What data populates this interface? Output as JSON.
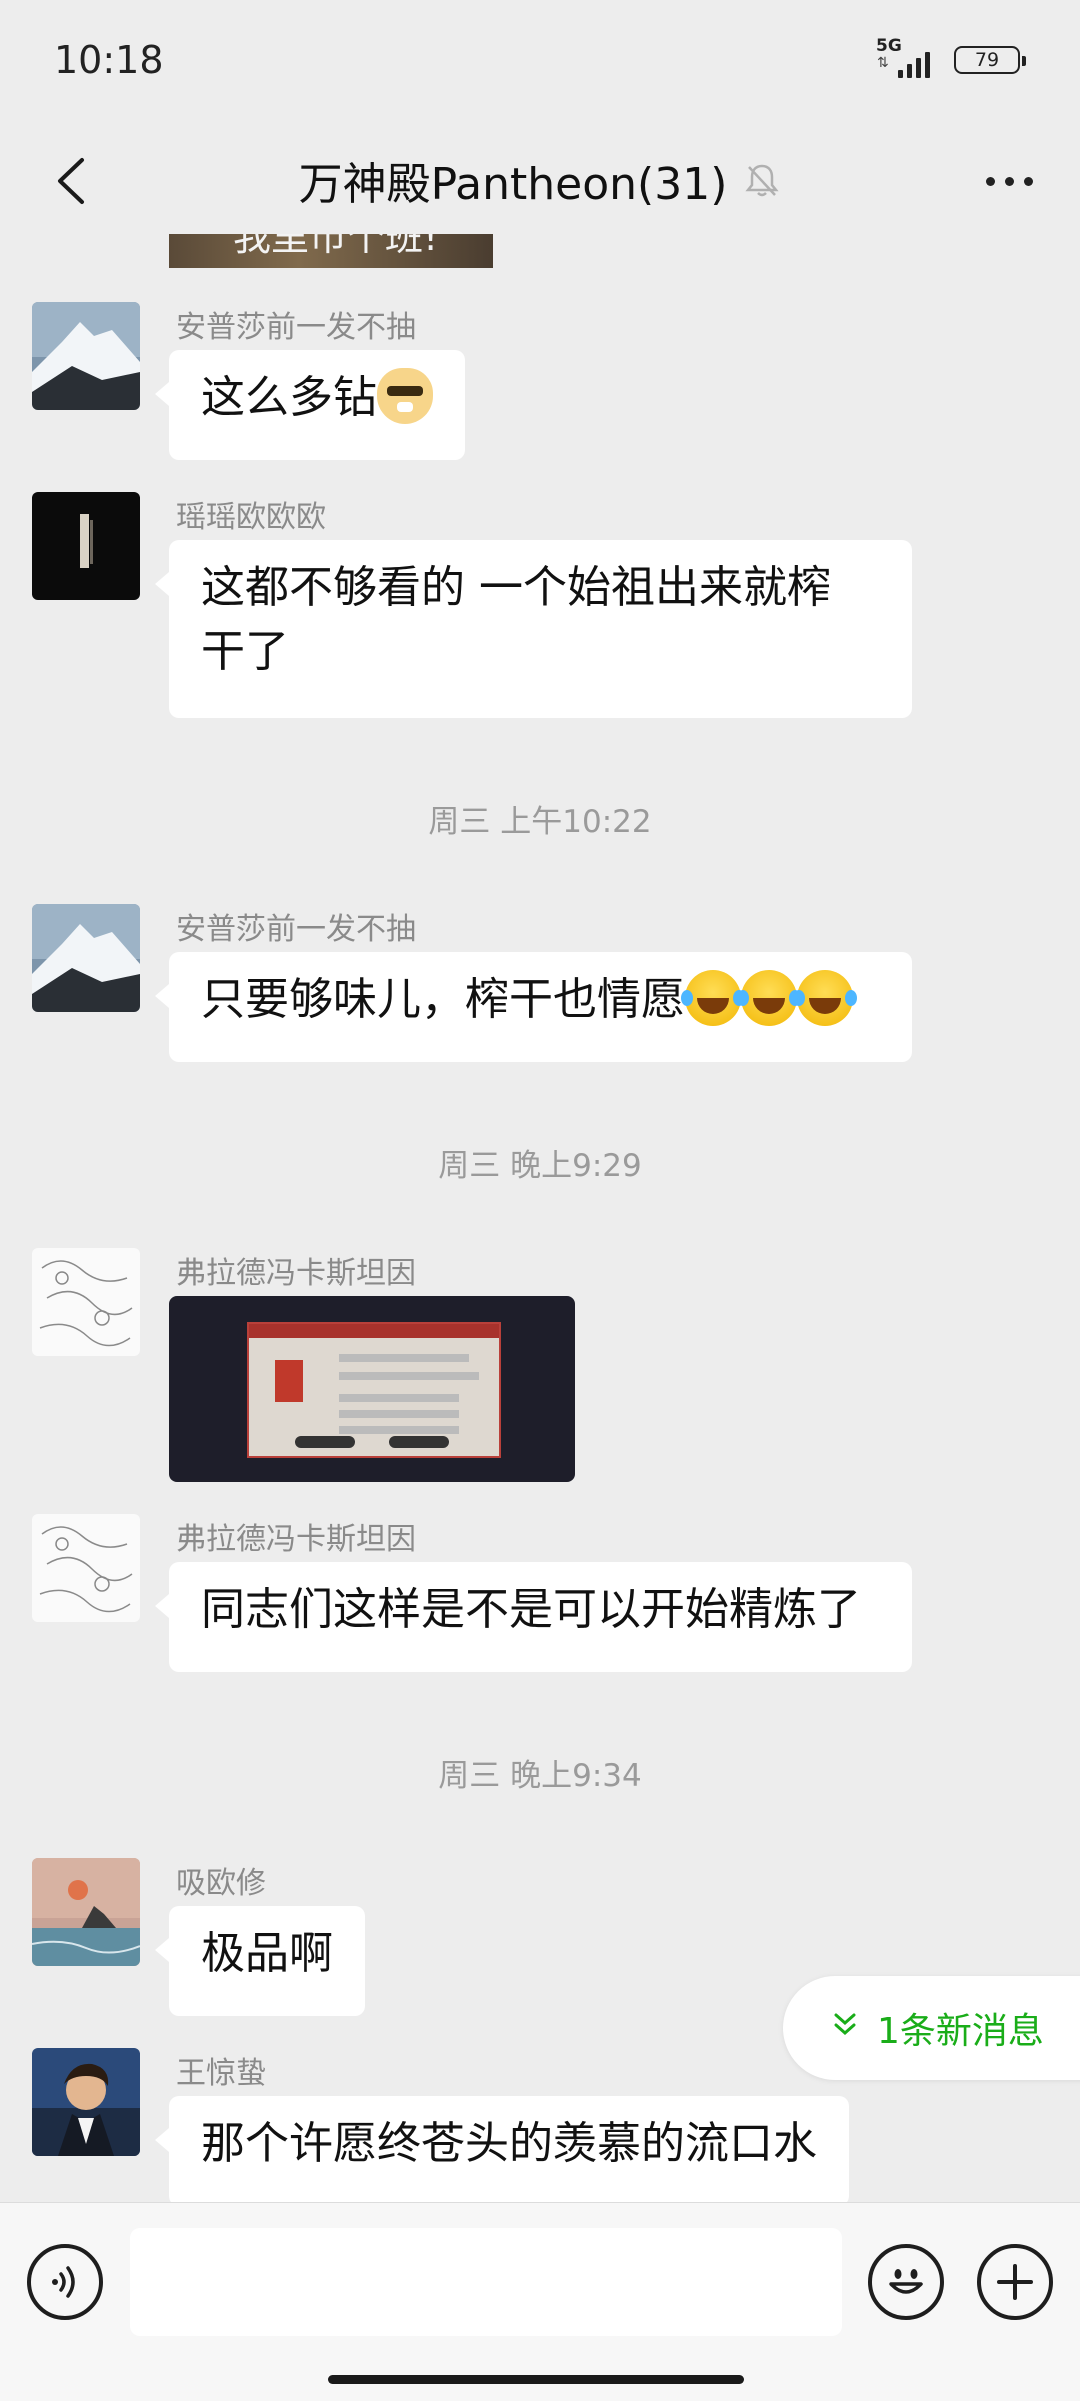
{
  "status": {
    "time": "10:18",
    "network": "5G",
    "battery": "79"
  },
  "header": {
    "title": "万神殿Pantheon(31)",
    "muted": true
  },
  "partial_image_caption": "我里市个班!",
  "messages": [
    {
      "sender": "安普莎前一发不抽",
      "text": "这么多钻",
      "emoji": "doge-sunglasses"
    },
    {
      "sender": "瑶瑶欧欧欧",
      "text_line1": "这都不够看的  一个始祖出来就榨",
      "text_line2": "干了"
    },
    {
      "timestamp": "周三 上午10:22"
    },
    {
      "sender": "安普莎前一发不抽",
      "text": "只要够味儿，榨干也情愿",
      "emoji": "tears-of-joy x3"
    },
    {
      "timestamp": "周三 晚上9:29"
    },
    {
      "sender": "弗拉德冯卡斯坦因",
      "type": "image"
    },
    {
      "sender": "弗拉德冯卡斯坦因",
      "text": "同志们这样是不是可以开始精炼了"
    },
    {
      "timestamp": "周三 晚上9:34"
    },
    {
      "sender": "吸欧修",
      "text": "极品啊"
    },
    {
      "sender": "王惊蛰",
      "text": "那个许愿终苍头的羡慕的流口水"
    }
  ],
  "new_message_pill": {
    "label": "1条新消息"
  },
  "input": {
    "placeholder": ""
  },
  "colors": {
    "background": "#ededed",
    "bubble": "#ffffff",
    "accent_green": "#1aad19",
    "meta_text": "#8a8a8a"
  }
}
